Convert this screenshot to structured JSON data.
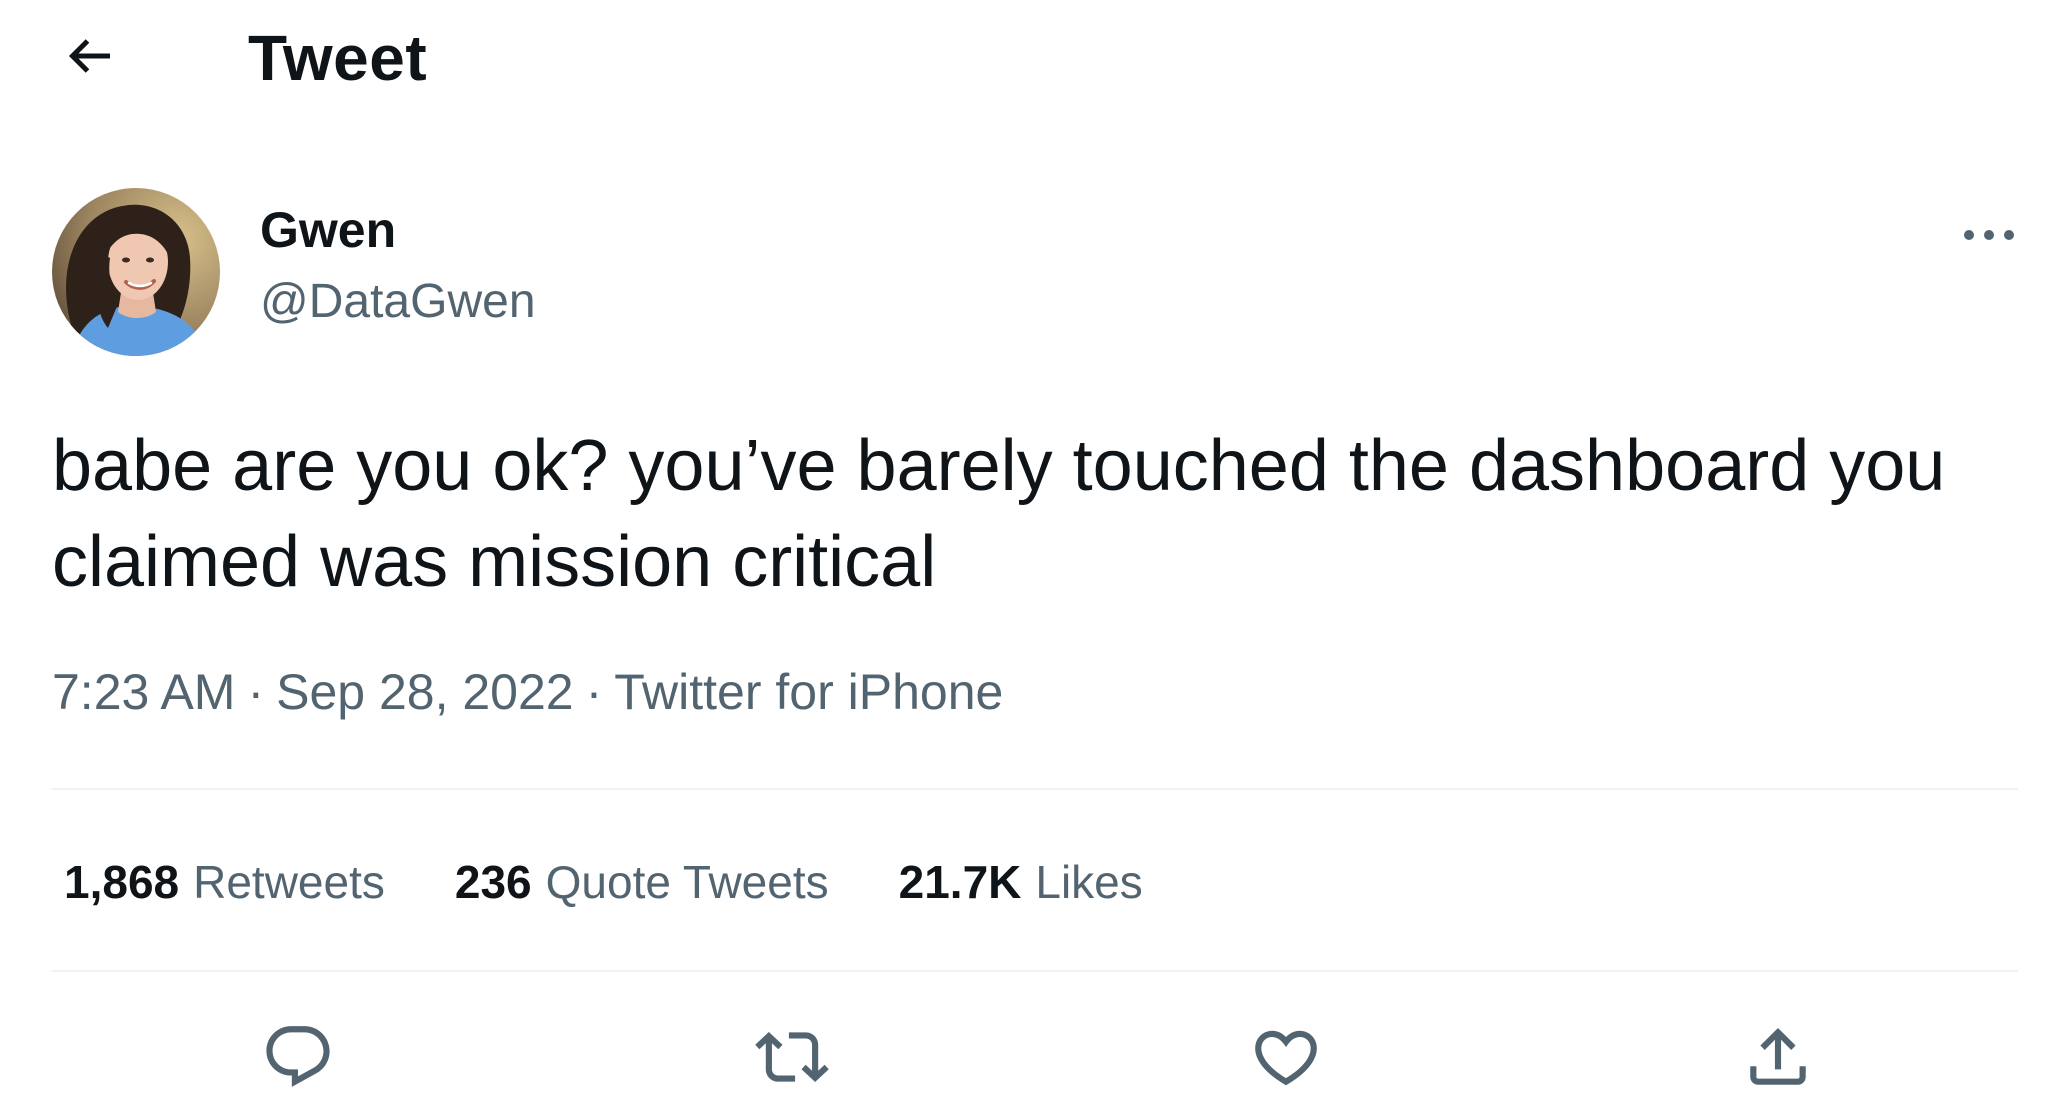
{
  "header": {
    "title": "Tweet",
    "back_icon": "arrow-left-icon"
  },
  "author": {
    "name": "Gwen",
    "handle": "@DataGwen",
    "avatar": "avatar-photo",
    "more_icon": "more-horizontal-icon"
  },
  "tweet": {
    "text": "babe are you ok? you’ve barely touched the dashboard you claimed was mission critical"
  },
  "meta": {
    "time": "7:23 AM",
    "separator": "·",
    "date": "Sep 28, 2022",
    "source": "Twitter for iPhone"
  },
  "stats": {
    "retweets_count": "1,868",
    "retweets_label": "Retweets",
    "quotes_count": "236",
    "quotes_label": "Quote Tweets",
    "likes_count": "21.7K",
    "likes_label": "Likes"
  },
  "actions": [
    {
      "name": "reply",
      "icon": "reply-icon"
    },
    {
      "name": "retweet",
      "icon": "retweet-icon"
    },
    {
      "name": "like",
      "icon": "heart-icon"
    },
    {
      "name": "share",
      "icon": "share-icon"
    }
  ],
  "colors": {
    "text_primary": "#0f1419",
    "text_secondary": "#536471",
    "divider": "#eff3f4"
  }
}
